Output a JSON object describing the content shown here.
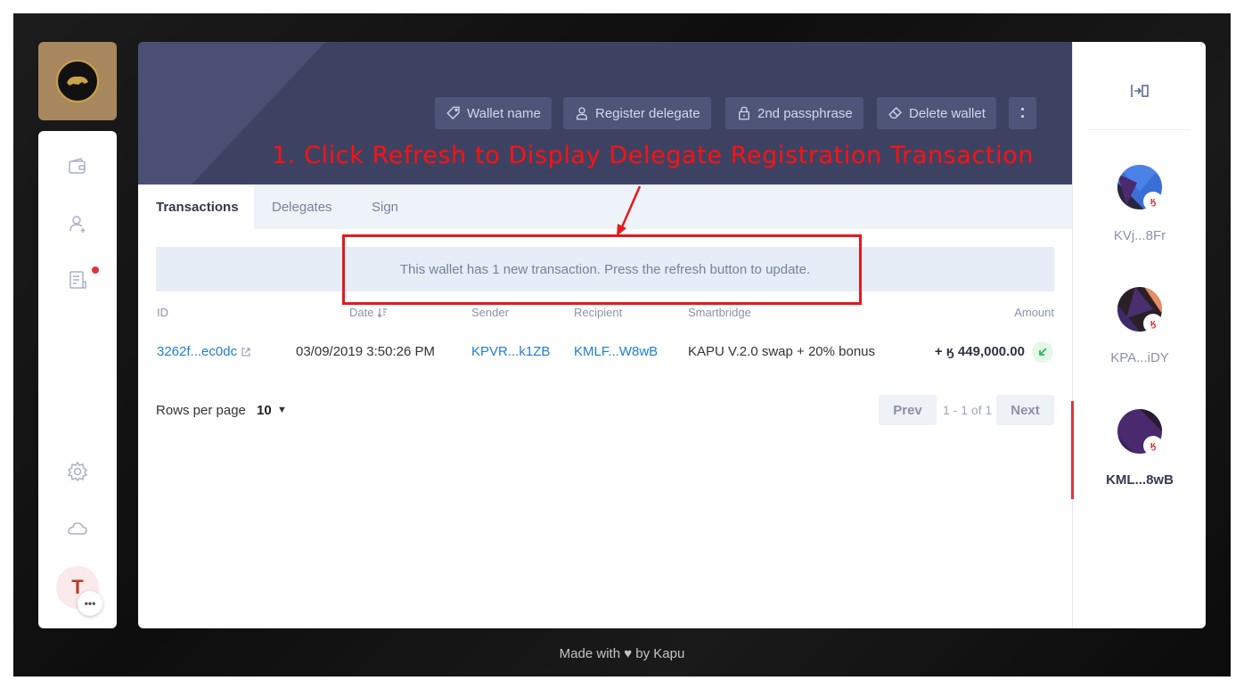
{
  "header": {
    "buttons": [
      {
        "label": "Wallet name",
        "icon": "tag-icon"
      },
      {
        "label": "Register delegate",
        "icon": "user-icon"
      },
      {
        "label": "2nd passphrase",
        "icon": "lock-icon"
      },
      {
        "label": "Delete wallet",
        "icon": "eraser-icon"
      }
    ],
    "more_label": "⁚"
  },
  "annotation": {
    "text": "1. Click Refresh to Display Delegate Registration Transaction",
    "color": "#ff1111"
  },
  "tabs": [
    {
      "label": "Transactions",
      "active": true
    },
    {
      "label": "Delegates",
      "active": false
    },
    {
      "label": "Sign",
      "active": false
    }
  ],
  "notice": {
    "text": "This wallet has 1 new transaction. Press the refresh button to update."
  },
  "table": {
    "columns": [
      "ID",
      "Date",
      "Sender",
      "Recipient",
      "Smartbridge",
      "Amount"
    ],
    "rows": [
      {
        "id": "3262f...ec0dc",
        "date": "03/09/2019 3:50:26 PM",
        "sender": "KPVR...k1ZB",
        "recipient": "KMLF...W8wB",
        "smartbridge": "KAPU V.2.0 swap + 20% bonus",
        "amount": "+ ӄ 449,000.00"
      }
    ]
  },
  "pagination": {
    "rows_label": "Rows per page",
    "rows_value": "10",
    "prev_label": "Prev",
    "page_info": "1 - 1 of 1",
    "next_label": "Next"
  },
  "profile": {
    "initial": "T"
  },
  "wallets": [
    {
      "label": "KVj...8Fr",
      "active": false
    },
    {
      "label": "KPA...iDY",
      "active": false
    },
    {
      "label": "KML...8wB",
      "active": true
    }
  ],
  "badge_glyph": "ӄ",
  "footer": {
    "text": "Made with ♥ by Kapu"
  },
  "colors": {
    "accent": "#e0343d",
    "header_bg": "#3e4262",
    "link": "#1f7ed6"
  }
}
